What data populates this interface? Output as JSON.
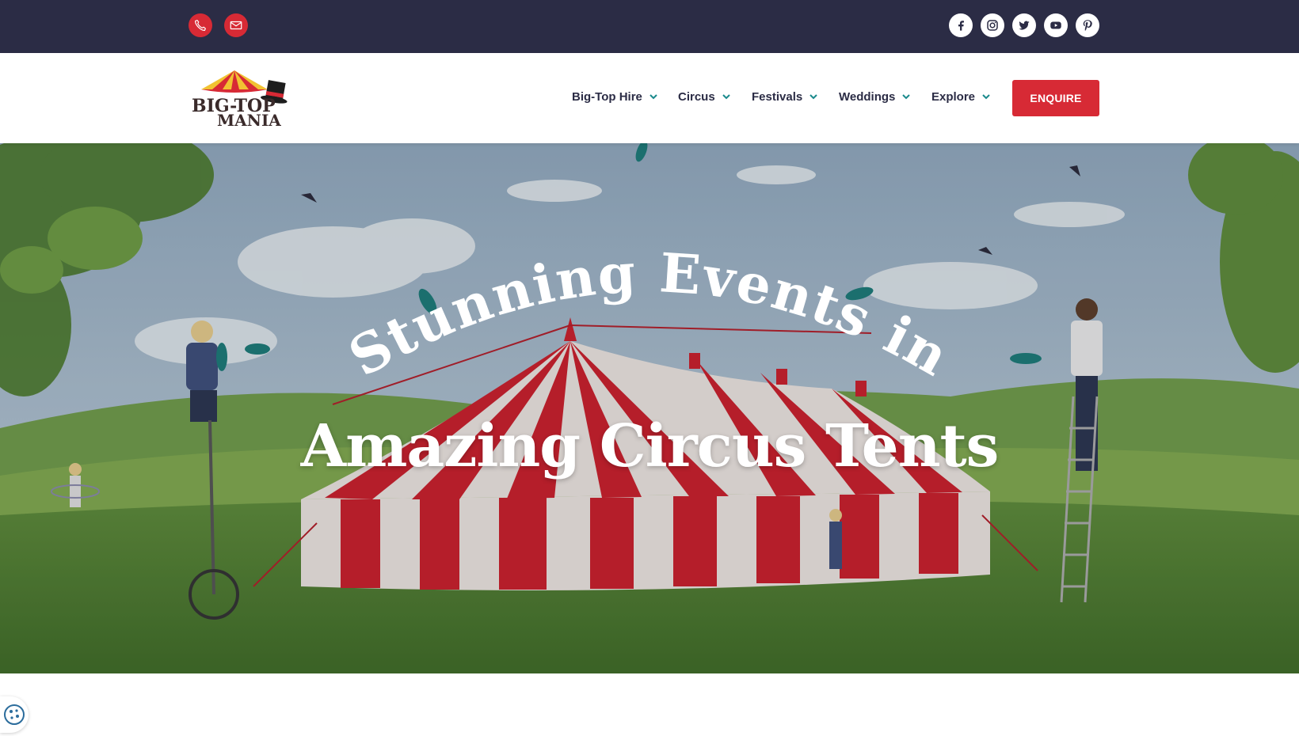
{
  "topbar": {
    "contact_icons": [
      "phone-icon",
      "email-icon"
    ],
    "social_icons": [
      "facebook-icon",
      "instagram-icon",
      "twitter-icon",
      "youtube-icon",
      "pinterest-icon"
    ]
  },
  "header": {
    "logo_text_line1": "BIG-TOP",
    "logo_text_line2": "MANIA",
    "nav": [
      {
        "label": "Big-Top Hire"
      },
      {
        "label": "Circus"
      },
      {
        "label": "Festivals"
      },
      {
        "label": "Weddings"
      },
      {
        "label": "Explore"
      }
    ],
    "enquire_label": "ENQUIRE"
  },
  "hero": {
    "title_line1": "Stunning Events in",
    "title_line2": "Amazing Circus Tents"
  },
  "colors": {
    "topbar_bg": "#2b2c45",
    "accent_red": "#d72a35",
    "nav_text": "#2b2c45",
    "chevron_teal": "#1a8a8c"
  }
}
